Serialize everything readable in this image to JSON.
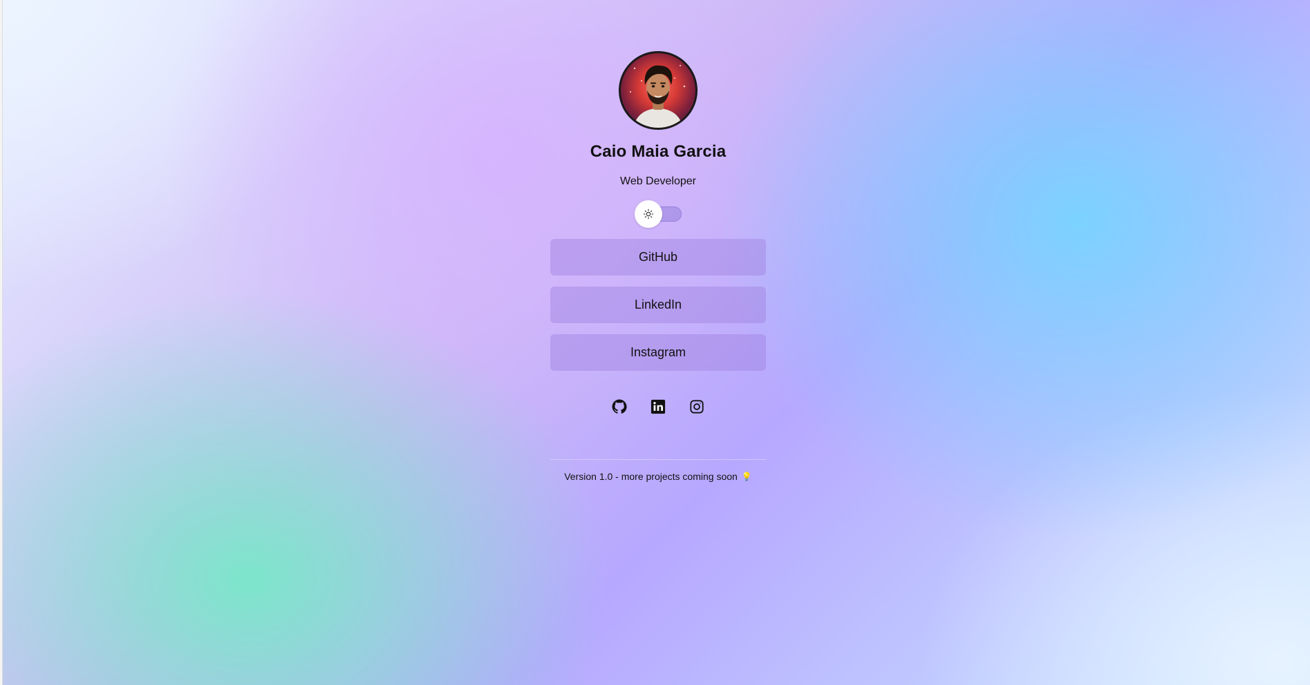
{
  "profile": {
    "name": "Caio Maia Garcia",
    "role": "Web Developer",
    "avatar_icon": "avatar-illustration"
  },
  "theme_toggle": {
    "icon": "sun-icon",
    "state": "light"
  },
  "links": [
    {
      "label": "GitHub"
    },
    {
      "label": "LinkedIn"
    },
    {
      "label": "Instagram"
    }
  ],
  "socials": [
    {
      "icon": "github-icon"
    },
    {
      "icon": "linkedin-icon"
    },
    {
      "icon": "instagram-icon"
    }
  ],
  "footer": {
    "text": "Version 1.0 - more projects coming soon",
    "emoji": "💡"
  }
}
